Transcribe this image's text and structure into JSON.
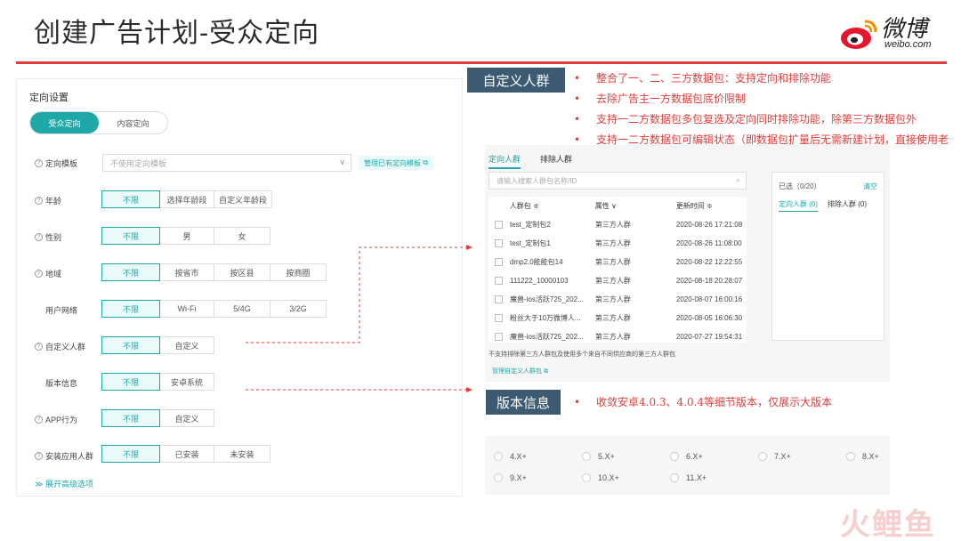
{
  "title": "创建广告计划-受众定向",
  "logo": {
    "text": "微博",
    "sub": "weibo.com"
  },
  "left": {
    "heading": "定向设置",
    "seg": [
      "受众定向",
      "内容定向"
    ],
    "template_label": "定向模板",
    "template_placeholder": "不使用定向模板",
    "template_manage": "管理已有定向模板",
    "rows": {
      "age": {
        "label": "年龄",
        "options": [
          "不限",
          "选择年龄段",
          "自定义年龄段"
        ]
      },
      "gender": {
        "label": "性别",
        "options": [
          "不限",
          "男",
          "女"
        ]
      },
      "region": {
        "label": "地域",
        "options": [
          "不限",
          "按省市",
          "按区县",
          "按商圈"
        ]
      },
      "network": {
        "label": "用户网络",
        "options": [
          "不限",
          "Wi-Fi",
          "5/4G",
          "3/2G"
        ]
      },
      "custom": {
        "label": "自定义人群",
        "options": [
          "不限",
          "自定义"
        ]
      },
      "version": {
        "label": "版本信息",
        "options": [
          "不限",
          "安卓系统"
        ]
      },
      "app": {
        "label": "APP行为",
        "options": [
          "不限",
          "自定义"
        ]
      },
      "install": {
        "label": "安装应用人群",
        "options": [
          "不限",
          "已安装",
          "未安装"
        ]
      }
    },
    "expand": "展开高级选项"
  },
  "callouts": {
    "custom": "自定义人群",
    "version": "版本信息"
  },
  "bullets": [
    "整合了一、二、三方数据包：支持定向和排除功能",
    "去除广告主一方数据包底价限制",
    "支持一二方数据包多包复选及定向同时排除功能，除第三方数据包外",
    "支持一二方数据包可编辑状态（即数据包扩量后无需新建计划，直接使用老计划），除第三方数据包外"
  ],
  "bullet_version": "收敛安卓4.0.3、4.0.4等细节版本，仅展示大版本",
  "crowd": {
    "tabs": [
      "定向人群",
      "排除人群"
    ],
    "search_placeholder": "请输入搜索人群包名称/ID",
    "headers": [
      "人群包 ≑",
      "属性 ∨",
      "更新时间 ≑"
    ],
    "rows": [
      [
        "test_定制包2",
        "第三方人群",
        "2020-08-26 17:21:08"
      ],
      [
        "test_定制包1",
        "第三方人群",
        "2020-08-26 11:08:00"
      ],
      [
        "dmp2.0能能包14",
        "第三方人群",
        "2020-08-22 12:22:55"
      ],
      [
        "111222_10000103",
        "第三方人群",
        "2020-08-18 20:28:07"
      ],
      [
        "魔兽-ios活跃725_202...",
        "第三方人群",
        "2020-08-07 16:00:16"
      ],
      [
        "粉丝大于10万微博人...",
        "第三方人群",
        "2020-08-05 16:06:30"
      ],
      [
        "魔兽-ios活跃725_202...",
        "第三方人群",
        "2020-07-27 19:54:31"
      ]
    ],
    "note": "不支持排除第三方人群包及使用多个来自不同供应商的第三方人群包",
    "manage": "管理自定义人群包",
    "selected": {
      "count": "已选（0/20）",
      "clear": "清空",
      "tab1": "定向人群 (0)",
      "tab2": "排除人群 (0)"
    }
  },
  "versions": [
    "4.X+",
    "5.X+",
    "6.X+",
    "7.X+",
    "8.X+",
    "9.X+",
    "10.X+",
    "11.X+"
  ],
  "watermark": "火鲤鱼",
  "colors": {
    "accent": "#1fa8a8",
    "red": "#e23d3a",
    "callout": "#3d5a73"
  }
}
